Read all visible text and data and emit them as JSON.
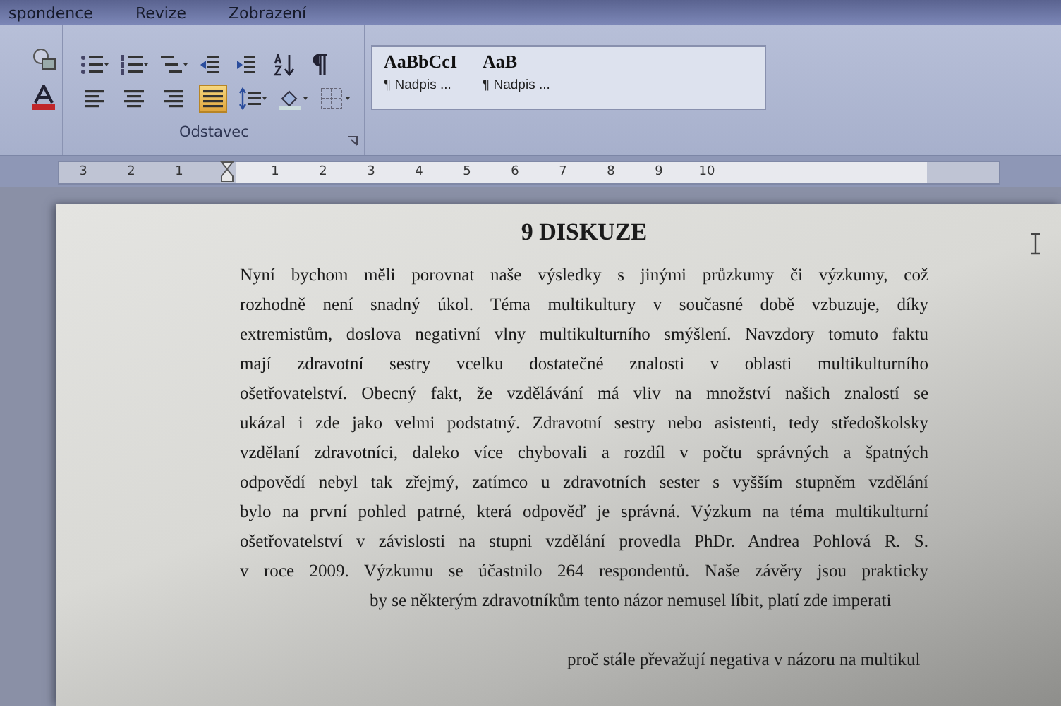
{
  "ribbon": {
    "tabs": [
      {
        "label": "spondence",
        "selected": false
      },
      {
        "label": "Revize",
        "selected": false
      },
      {
        "label": "Zobrazení",
        "selected": false
      }
    ],
    "paragraph_group": {
      "label": "Odstavec",
      "alignment_buttons": [
        {
          "kind": "left",
          "selected": false
        },
        {
          "kind": "center",
          "selected": false
        },
        {
          "kind": "right",
          "selected": false
        },
        {
          "kind": "justify",
          "selected": true
        }
      ]
    },
    "styles_gallery": [
      {
        "sample": "AaBbCcI",
        "name": "¶ Nadpis ..."
      },
      {
        "sample": "AaB",
        "name": "¶ Nadpis ..."
      }
    ]
  },
  "ruler": {
    "left_numbers": [
      "3",
      "2",
      "1"
    ],
    "right_numbers": [
      "1",
      "2",
      "3",
      "4",
      "5",
      "6",
      "7",
      "8",
      "9",
      "10"
    ]
  },
  "document": {
    "heading": "9 DISKUZE",
    "lines": [
      {
        "kind": "full",
        "text": "Nyní bychom měli porovnat naše výsledky s jinými průzkumy či výzkumy, což"
      },
      {
        "kind": "full",
        "text": "rozhodně není snadný úkol. Téma multikultury v současné době vzbuzuje, díky"
      },
      {
        "kind": "full",
        "text": "extremistům, doslova negativní vlny multikulturního smýšlení. Navzdory tomuto faktu"
      },
      {
        "kind": "full",
        "text": "mají zdravotní sestry vcelku dostatečné znalosti v oblasti multikulturního"
      },
      {
        "kind": "full",
        "text": "ošetřovatelství. Obecný fakt, že vzdělávání má vliv na množství našich znalostí se"
      },
      {
        "kind": "full",
        "text": "ukázal i zde jako velmi podstatný. Zdravotní sestry nebo asistenti, tedy středoškolsky"
      },
      {
        "kind": "full",
        "text": "vzdělaní zdravotníci, daleko více chybovali a rozdíl v počtu správných a špatných"
      },
      {
        "kind": "full",
        "text": "odpovědí nebyl tak zřejmý, zatímco u zdravotních sester s vyšším stupněm vzdělání"
      },
      {
        "kind": "full",
        "text": "bylo na první pohled patrné, která odpověď je správná. Výzkum na téma multikulturní"
      },
      {
        "kind": "full",
        "text": "ošetřovatelství v závislosti na stupni vzdělání provedla PhDr. Andrea Pohlová R. S."
      },
      {
        "kind": "full",
        "text": "v roce 2009. Výzkumu se účastnilo 264 respondentů. Naše závěry jsou prakticky"
      },
      {
        "kind": "cut",
        "text": "by se některým zdravotníkům tento názor nemusel líbit, platí zde imperati"
      },
      {
        "kind": "gap"
      },
      {
        "kind": "cut",
        "text": "proč stále převažují negativa v názoru na multikul"
      }
    ]
  }
}
